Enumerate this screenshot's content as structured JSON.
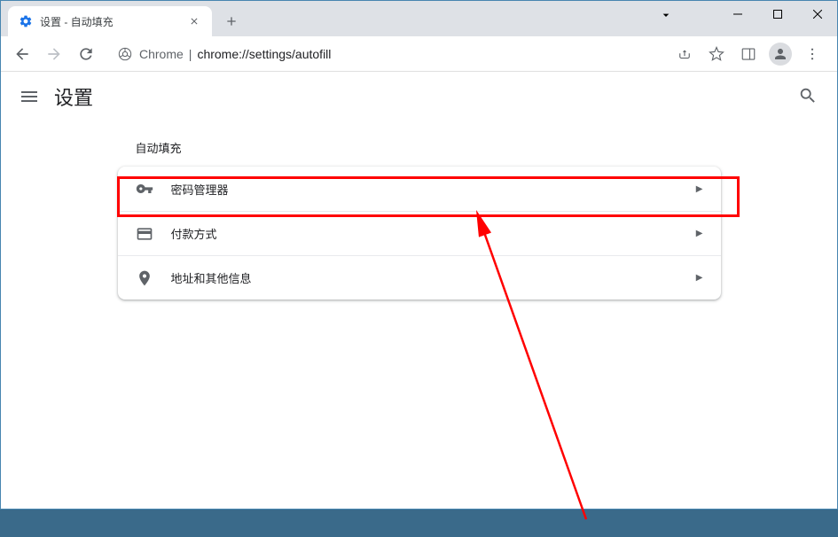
{
  "tab": {
    "title": "设置 - 自动填充"
  },
  "url": {
    "prefix": "Chrome",
    "path": "chrome://settings/autofill"
  },
  "header": {
    "title": "设置"
  },
  "section": {
    "title": "自动填充",
    "rows": [
      {
        "label": "密码管理器"
      },
      {
        "label": "付款方式"
      },
      {
        "label": "地址和其他信息"
      }
    ]
  }
}
